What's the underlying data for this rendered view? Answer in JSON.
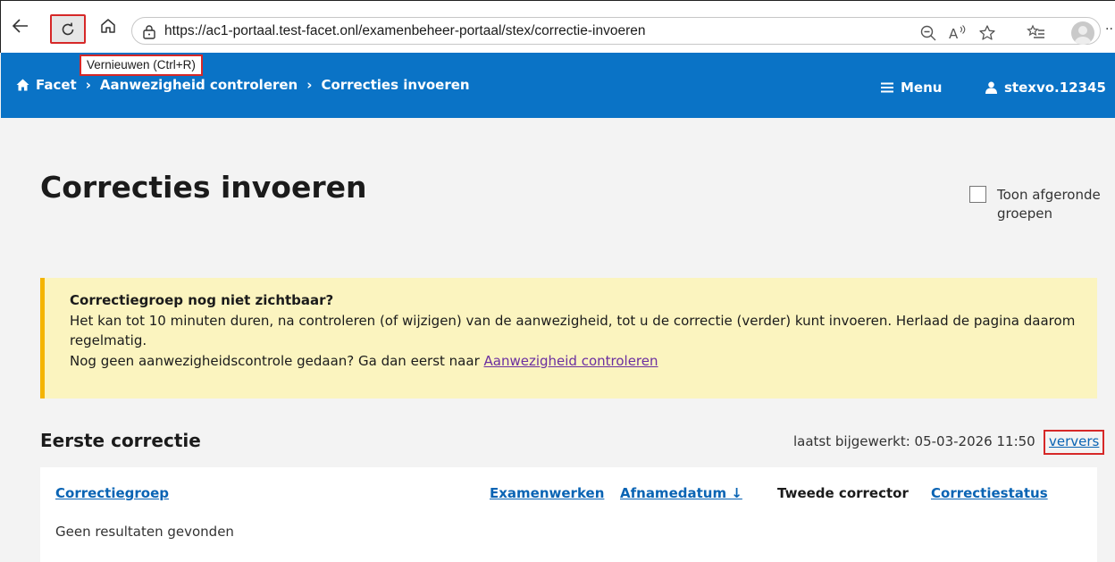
{
  "browser": {
    "url": "https://ac1-portaal.test-facet.onl/examenbeheer-portaal/stex/correctie-invoeren",
    "tooltip": "Vernieuwen (Ctrl+R)",
    "more": "··"
  },
  "header": {
    "breadcrumbs": [
      "Facet",
      "Aanwezigheid controleren",
      "Correcties invoeren"
    ],
    "separator": "›",
    "menu_label": "Menu",
    "user_label": "stexvo.12345"
  },
  "page": {
    "title": "Correcties invoeren",
    "toggle_label": "Toon afgeronde groepen",
    "toggle_checked": false
  },
  "notice": {
    "title": "Correctiegroep nog niet zichtbaar?",
    "line1": "Het kan tot 10 minuten duren, na controleren (of wijzigen) van de aanwezigheid, tot u de correctie (verder) kunt invoeren. Herlaad de pagina daarom regelmatig.",
    "line2_prefix": "Nog geen aanwezigheidscontrole gedaan? Ga dan eerst naar ",
    "line2_link": "Aanwezigheid controleren"
  },
  "section": {
    "title": "Eerste correctie",
    "updated_text": "laatst bijgewerkt: 05-03-2026 11:50",
    "refresh_label": "ververs"
  },
  "table": {
    "columns": [
      "Correctiegroep",
      "Examenwerken",
      "Afnamedatum ↓",
      "Tweede corrector",
      "Correctiestatus"
    ],
    "empty_text": "Geen resultaten gevonden"
  },
  "colors": {
    "header_blue": "#0a73c6",
    "notice_bg": "#fbf4bf",
    "notice_border": "#f4b400",
    "highlight_red": "#d62828",
    "link_blue": "#0a64b4"
  }
}
